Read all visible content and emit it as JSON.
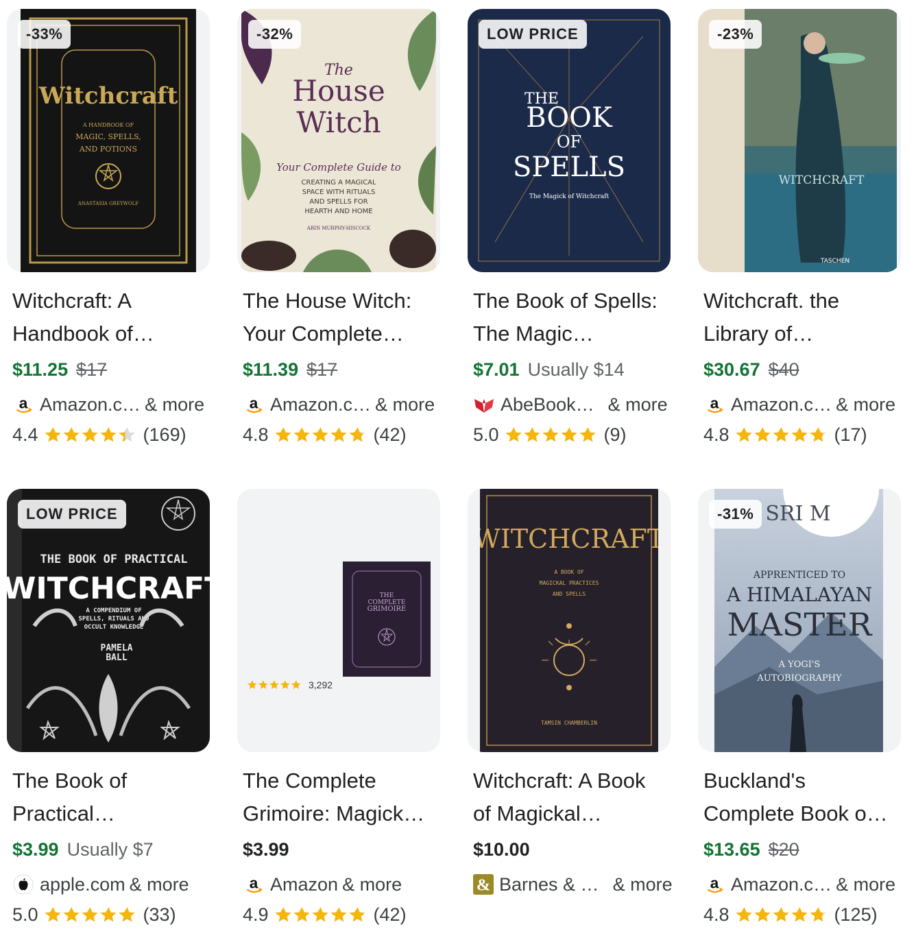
{
  "colors": {
    "price_green": "#137333",
    "star_gold": "#f5b50a",
    "muted": "#5f6368"
  },
  "products": [
    {
      "badge": "-33%",
      "title": "Witchcraft: A Handbook of…",
      "price": "$11.25",
      "old_price": "$17",
      "usually": "",
      "seller": "Amazon.c…",
      "more": "& more",
      "seller_icon": "amazon-icon",
      "rating": "4.4",
      "stars": 4.4,
      "reviews": "(169)",
      "cover_text": {
        "title": "Witchcraft",
        "sub1": "A HANDBOOK OF",
        "sub2": "MAGIC, SPELLS,",
        "sub3": "AND POTIONS",
        "author": "ANASTASIA GREYWOLF"
      }
    },
    {
      "badge": "-32%",
      "title": "The House Witch: Your Complete…",
      "price": "$11.39",
      "old_price": "$17",
      "usually": "",
      "seller": "Amazon.c…",
      "more": "& more",
      "seller_icon": "amazon-icon",
      "rating": "4.8",
      "stars": 4.8,
      "reviews": "(42)",
      "cover_text": {
        "pre": "The",
        "title1": "House",
        "title2": "Witch",
        "tag": "Your Complete Guide to",
        "l1": "CREATING A MAGICAL",
        "l2": "SPACE WITH RITUALS",
        "l3": "AND SPELLS FOR",
        "l4": "HEARTH AND HOME",
        "author": "ARIN MURPHY-HISCOCK"
      }
    },
    {
      "badge": "LOW PRICE",
      "title": "The Book of Spells: The Magic…",
      "price": "$7.01",
      "old_price": "",
      "usually": "Usually $14",
      "seller": "AbeBook…",
      "more": "& more",
      "seller_icon": "abebooks-icon",
      "rating": "5.0",
      "stars": 5,
      "reviews": "(9)",
      "cover_text": {
        "l1": "THE",
        "l2": "BOOK",
        "l3": "OF",
        "l4": "SPELLS",
        "sub": "The Magick of Witchcraft"
      }
    },
    {
      "badge": "-23%",
      "title": "Witchcraft. the Library of…",
      "price": "$30.67",
      "old_price": "$40",
      "usually": "",
      "seller": "Amazon.c…",
      "more": "& more",
      "seller_icon": "amazon-icon",
      "rating": "4.8",
      "stars": 4.8,
      "reviews": "(17)",
      "cover_text": {
        "title": "WITCHCRAFT",
        "pub": "TASCHEN"
      }
    },
    {
      "badge": "LOW PRICE",
      "title": "The Book of Practical…",
      "price": "$3.99",
      "old_price": "",
      "usually": "Usually $7",
      "seller": "apple.com",
      "more": "& more",
      "seller_icon": "apple-icon",
      "rating": "5.0",
      "stars": 5,
      "reviews": "(33)",
      "cover_text": {
        "top": "THE BOOK OF PRACTICAL",
        "title": "WITCHCRAFT",
        "sub1": "A COMPENDIUM OF",
        "sub2": "SPELLS, RITUALS AND",
        "sub3": "OCCULT KNOWLEDGE",
        "author1": "PAMELA",
        "author2": "BALL"
      }
    },
    {
      "badge": "",
      "title": "The Complete Grimoire: Magick…",
      "price": "$3.99",
      "old_price": "",
      "usually": "",
      "seller": "Amazon",
      "more": "& more",
      "seller_icon": "amazon-icon",
      "rating": "4.9",
      "stars": 4.9,
      "reviews": "(42)",
      "cover_text": {
        "l1": "THE",
        "l2": "COMPLETE",
        "l3": "GRIMOIRE",
        "count": "3,292"
      }
    },
    {
      "badge": "",
      "title": "Witchcraft: A Book of Magickal…",
      "price": "$10.00",
      "old_price": "",
      "usually": "",
      "seller": "Barnes & …",
      "more": "& more",
      "seller_icon": "barnes-icon",
      "rating": "",
      "stars": 0,
      "reviews": "",
      "cover_text": {
        "title": "WITCHCRAFT",
        "s1": "A BOOK OF",
        "s2": "MAGICKAL PRACTICES",
        "s3": "AND SPELLS",
        "author": "TAMSIN CHAMBERLIN"
      }
    },
    {
      "badge": "-31%",
      "title": "Buckland's Complete Book o…",
      "price": "$13.65",
      "old_price": "$20",
      "usually": "",
      "seller": "Amazon.c…",
      "more": "& more",
      "seller_icon": "amazon-icon",
      "rating": "4.8",
      "stars": 4.8,
      "reviews": "(125)",
      "cover_text": {
        "author": "SRI M",
        "l1": "APPRENTICED TO",
        "l2": "A HIMALAYAN",
        "l3": "MASTER",
        "l4": "A YOGI'S",
        "l5": "AUTOBIOGRAPHY"
      }
    }
  ]
}
